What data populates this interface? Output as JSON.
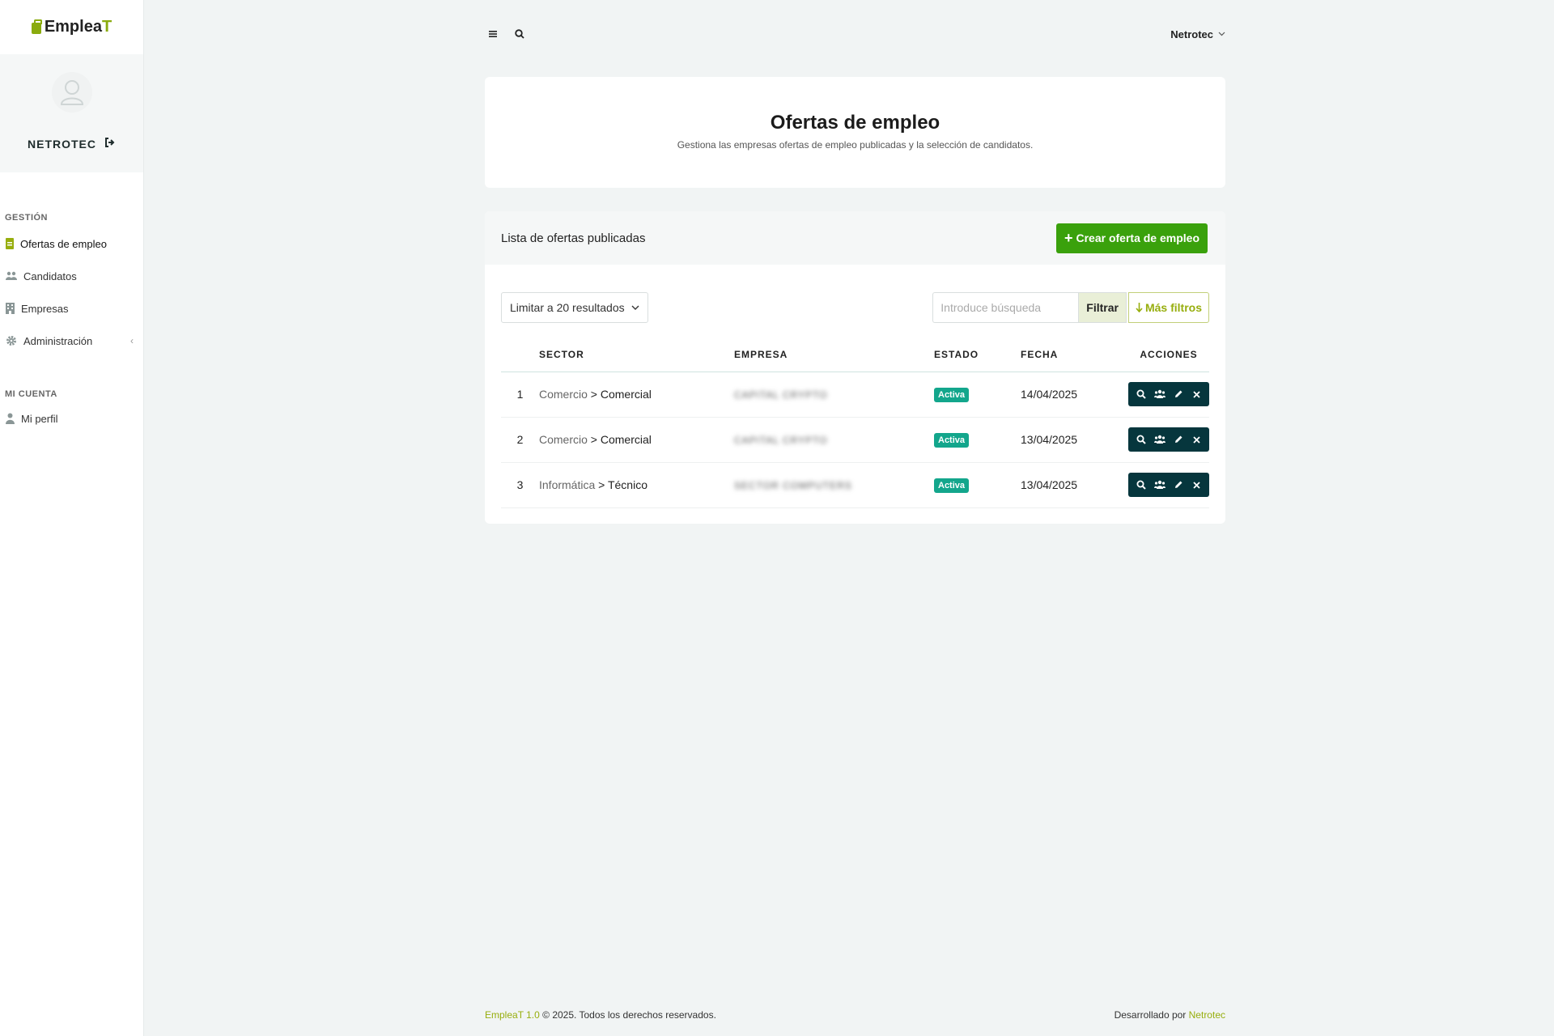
{
  "brand": {
    "name_main": "Emplea",
    "name_accent": "T"
  },
  "profile": {
    "name": "NETROTEC"
  },
  "nav": {
    "section_gestion": "GESTIÓN",
    "items": [
      {
        "label": "Ofertas de empleo",
        "icon": "file-icon",
        "active": true
      },
      {
        "label": "Candidatos",
        "icon": "users-icon"
      },
      {
        "label": "Empresas",
        "icon": "building-icon"
      },
      {
        "label": "Administración",
        "icon": "gear-icon"
      }
    ],
    "section_cuenta": "MI CUENTA",
    "account_items": [
      {
        "label": "Mi perfil",
        "icon": "user-icon"
      }
    ]
  },
  "topbar": {
    "user": "Netrotec"
  },
  "header": {
    "title": "Ofertas de empleo",
    "subtitle": "Gestiona las empresas ofertas de empleo publicadas y la selección de candidatos."
  },
  "list": {
    "title": "Lista de ofertas publicadas",
    "create_label": "Crear oferta de empleo",
    "limit_label": "Limitar a 20 resultados",
    "search_placeholder": "Introduce búsqueda",
    "filter_label": "Filtrar",
    "more_filters_label": "Más filtros",
    "columns": {
      "sector": "SECTOR",
      "empresa": "EMPRESA",
      "estado": "ESTADO",
      "fecha": "FECHA",
      "acciones": "ACCIONES"
    },
    "rows": [
      {
        "num": "1",
        "sector_parent": "Comercio",
        "sector_child": "Comercial",
        "empresa": "CAPITAL CRYPTO",
        "estado": "Activa",
        "fecha": "14/04/2025"
      },
      {
        "num": "2",
        "sector_parent": "Comercio",
        "sector_child": "Comercial",
        "empresa": "CAPITAL CRYPTO",
        "estado": "Activa",
        "fecha": "13/04/2025"
      },
      {
        "num": "3",
        "sector_parent": "Informática",
        "sector_child": "Técnico",
        "empresa": "SECTOR COMPUTERS",
        "estado": "Activa",
        "fecha": "13/04/2025"
      }
    ]
  },
  "footer": {
    "brand_version": "EmpleaT 1.0",
    "copyright": " © 2025. Todos los derechos reservados.",
    "dev_prefix": "Desarrollado por ",
    "dev_name": "Netrotec"
  },
  "colors": {
    "accent": "#8aab0e",
    "primary_green": "#3aa10c",
    "badge": "#13a68c",
    "actions_bg": "#06363d"
  }
}
